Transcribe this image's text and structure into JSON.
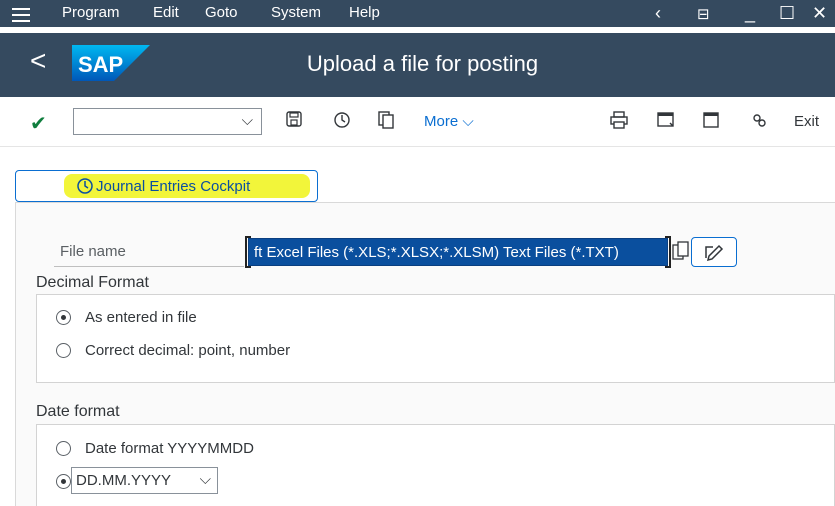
{
  "menubar": {
    "items": [
      "Program",
      "Edit",
      "Goto",
      "System",
      "Help"
    ]
  },
  "titlebar": {
    "logo_text": "SAP",
    "title": "Upload a file for posting"
  },
  "toolbar": {
    "command_field_value": "",
    "more_label": "More",
    "exit_label": "Exit"
  },
  "content": {
    "cockpit_button_label": "Journal Entries Cockpit",
    "file_name_label": "File name",
    "file_name_value": "ft Excel Files (*.XLS;*.XLSX;*.XLSM) Text Files (*.TXT)",
    "decimal_format": {
      "heading": "Decimal Format",
      "options": [
        "As entered in file",
        "Correct decimal: point, number"
      ],
      "selected": 0
    },
    "date_format": {
      "heading": "Date format",
      "option_label": "Date format YYYYMMDD",
      "select_value": "DD.MM.YYYY"
    }
  },
  "colors": {
    "shell": "#354a5f",
    "accent": "#0a6ed1",
    "highlight": "#f2f53a",
    "field_selected": "#0a4f9e"
  }
}
